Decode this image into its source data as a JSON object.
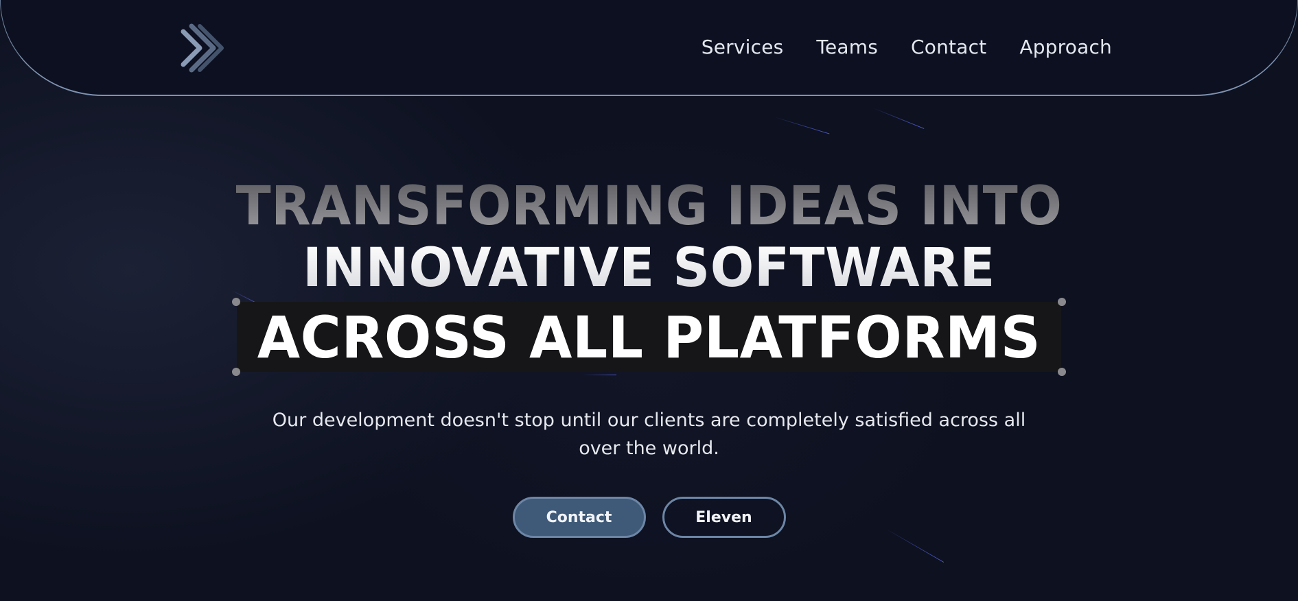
{
  "header": {
    "logo_icon": "arrow-right-diamond-icon",
    "nav": [
      {
        "label": "Services"
      },
      {
        "label": "Teams"
      },
      {
        "label": "Contact"
      },
      {
        "label": "Approach"
      }
    ]
  },
  "hero": {
    "line1": "TRANSFORMING IDEAS INTO",
    "line2": "INNOVATIVE SOFTWARE",
    "line3": "ACROSS ALL PLATFORMS",
    "subtitle": "Our development doesn't stop until our clients are completely satisfied across all over the world.",
    "primary_button": "Contact",
    "secondary_button": "Eleven"
  },
  "colors": {
    "background": "#0d1120",
    "header_border": "#7f93b1",
    "primary_button": "#3f5a78",
    "button_border": "#6d86a6",
    "highlight_box": "#161618"
  }
}
